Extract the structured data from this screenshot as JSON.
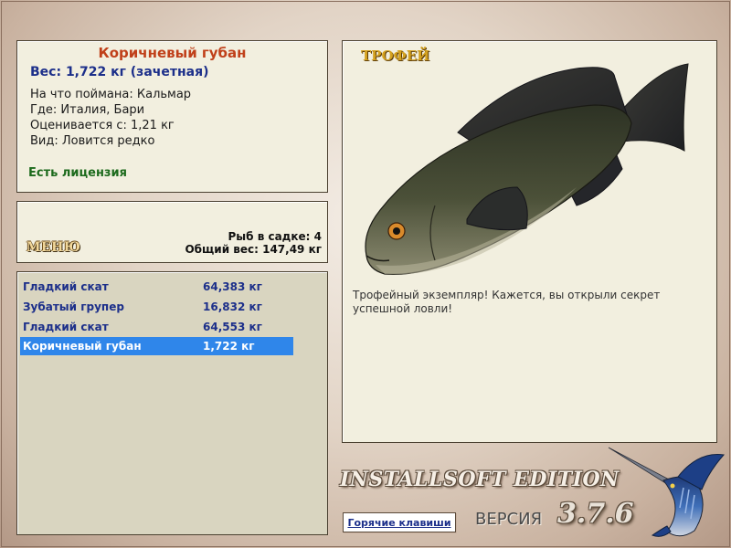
{
  "info": {
    "fish_name": "Коричневый губан",
    "weight_line": "Вес: 1,722 кг (зачетная)",
    "details": [
      "На что поймана: Кальмар",
      "Где: Италия, Бари",
      "Оценивается с: 1,21 кг",
      "Вид: Ловится редко"
    ],
    "license": "Есть лицензия"
  },
  "menu": {
    "menu_label": "МЕНЮ",
    "fish_in_keepnet": "Рыб в садке: 4",
    "total_weight": "Общий вес: 147,49 кг"
  },
  "catch_list": [
    {
      "name": "Гладкий скат",
      "weight": "64,383 кг",
      "selected": false
    },
    {
      "name": "Зубатый групер",
      "weight": "16,832 кг",
      "selected": false
    },
    {
      "name": "Гладкий скат",
      "weight": "64,553 кг",
      "selected": false
    },
    {
      "name": "Коричневый губан",
      "weight": "1,722 кг",
      "selected": true
    }
  ],
  "trophy": {
    "label": "ТРОФЕЙ",
    "description": "Трофейный экземпляр! Кажется, вы открыли секрет успешной ловли!"
  },
  "footer": {
    "edition": "INSTALLSOFT EDITION",
    "version_label": "ВЕРСИЯ",
    "version_number": "3.7.6",
    "hotkeys_label": "Горячие клавиши"
  },
  "colors": {
    "selected_row": "#2f86ea",
    "fish_title": "#c0401a",
    "list_text": "#1c2f8a",
    "license_text": "#1c6a1c",
    "trophy_label": "#d4a11e"
  }
}
